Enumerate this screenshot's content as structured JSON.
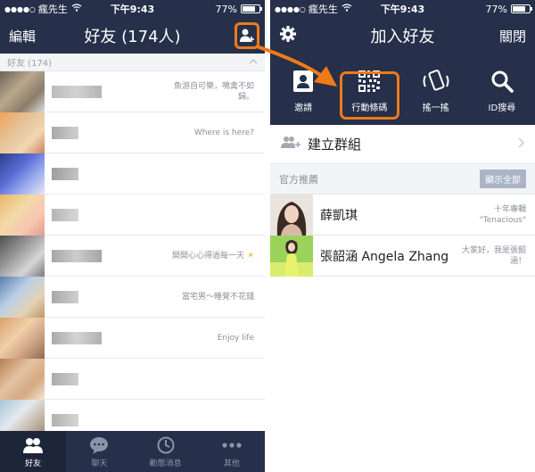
{
  "left": {
    "status": {
      "dots": "●●●●○",
      "carrier": "瘋先生",
      "time": "下午9:43",
      "battery": "77%",
      "battery_level": 0.77
    },
    "nav": {
      "left": "編輯",
      "title": "好友 (174人)"
    },
    "section_label": "好友 (174)",
    "friends": [
      {
        "status": "魚游自可樂，鳴禽不如歸。"
      },
      {
        "status": "Where is here?"
      },
      {
        "status": ""
      },
      {
        "status": ""
      },
      {
        "status": "開開心心得過每一天"
      },
      {
        "status": "當宅男～睡覺不花錢"
      },
      {
        "status": "Enjoy life"
      },
      {
        "status": ""
      },
      {
        "status": ""
      }
    ],
    "tabs": [
      {
        "label": "好友",
        "icon": "friends-icon"
      },
      {
        "label": "聊天",
        "icon": "chat-icon"
      },
      {
        "label": "動態消息",
        "icon": "timeline-icon"
      },
      {
        "label": "其他",
        "icon": "more-icon"
      }
    ]
  },
  "right": {
    "status": {
      "dots": "●●●●○",
      "carrier": "瘋先生",
      "time": "下午9:43",
      "battery": "77%",
      "battery_level": 0.77
    },
    "nav": {
      "title": "加入好友",
      "right": "關閉"
    },
    "tools": [
      {
        "label": "邀請",
        "icon": "invite-icon"
      },
      {
        "label": "行動條碼",
        "icon": "qr-code-icon"
      },
      {
        "label": "搖一搖",
        "icon": "shake-icon"
      },
      {
        "label": "ID搜尋",
        "icon": "search-icon"
      }
    ],
    "create_group": "建立群組",
    "recommend_header": "官方推薦",
    "show_all": "顯示全部",
    "recommended": [
      {
        "name": "薛凱琪",
        "desc": "十年專輯 \"Tenacious\""
      },
      {
        "name": "張韶涵 Angela Zhang",
        "desc": "大家好，我是張韶涵！"
      }
    ]
  },
  "colors": {
    "navy": "#26304a",
    "accent": "#ef7a1a"
  }
}
